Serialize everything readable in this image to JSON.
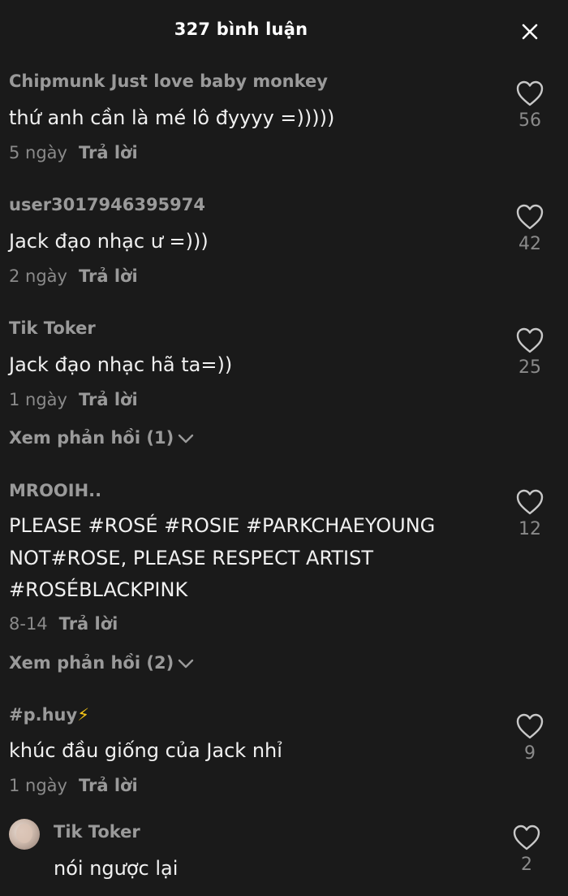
{
  "header": {
    "title": "327 bình luận",
    "close_icon": "close-icon"
  },
  "comments": [
    {
      "username": "Chipmunk Just love baby monkey",
      "text": "thứ anh cần là mé lô đyyyy =)))))",
      "time": "5 ngày",
      "reply_label": "Trả lời",
      "likes": "56"
    },
    {
      "username": "user3017946395974",
      "text": "Jack đạo nhạc ư =)))",
      "time": "2 ngày",
      "reply_label": "Trả lời",
      "likes": "42"
    },
    {
      "username": "Tik Toker",
      "text": "Jack đạo nhạc hã ta=))",
      "time": "1 ngày",
      "reply_label": "Trả lời",
      "likes": "25",
      "view_replies": "Xem phản hồi (1)"
    },
    {
      "username": "MROOIH..",
      "text_lines": [
        "PLEASE #ROSÉ #ROSIE #PARKCHAEYOUNG",
        "NOT#ROSE, PLEASE RESPECT ARTIST",
        "#ROSÉBLACKPINK"
      ],
      "time": "8-14",
      "reply_label": "Trả lời",
      "likes": "12",
      "view_replies": "Xem phản hồi (2)"
    },
    {
      "username": "#p.huy",
      "username_emoji": "⚡",
      "text": "khúc đầu giống của Jack nhỉ",
      "time": "1 ngày",
      "reply_label": "Trả lời",
      "likes": "9"
    }
  ],
  "reply": {
    "username": "Tik Toker",
    "text": "nói ngược lại",
    "likes": "2"
  },
  "icons": {
    "like": "heart-outline-icon",
    "expand": "chevron-down-icon"
  }
}
